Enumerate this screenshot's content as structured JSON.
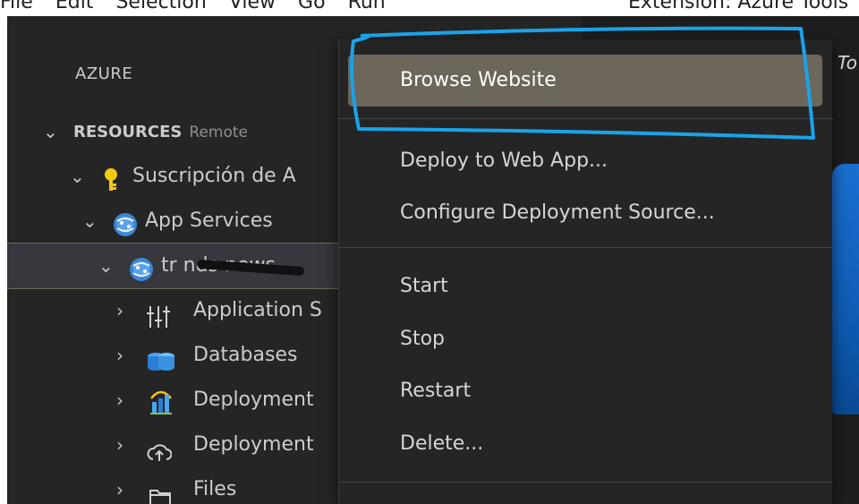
{
  "menubar": {
    "items": [
      "File",
      "Edit",
      "Selection",
      "View",
      "Go",
      "Run"
    ],
    "extension_title": "Extension: Azure Tools"
  },
  "editor": {
    "tab_fragment": "To"
  },
  "sidebar": {
    "header": "AZURE",
    "resources": {
      "title": "RESOURCES",
      "subtitle": "Remote"
    },
    "subscription": {
      "label": "Suscripción de A"
    },
    "app_services": {
      "label": "App Services"
    },
    "webapp": {
      "label": "tr nds news"
    },
    "children": [
      {
        "label": "Application S",
        "icon": "sliders-icon"
      },
      {
        "label": "Databases",
        "icon": "database-icon"
      },
      {
        "label": "Deployment",
        "icon": "bar-chart-icon"
      },
      {
        "label": "Deployment",
        "icon": "cloud-upload-icon"
      },
      {
        "label": "Files",
        "icon": "folder-icon"
      }
    ]
  },
  "context_menu": {
    "browse": "Browse Website",
    "deploy": "Deploy to Web App...",
    "configure": "Configure Deployment Source...",
    "start": "Start",
    "stop": "Stop",
    "restart": "Restart",
    "delete": "Delete..."
  },
  "colors": {
    "sidebar_bg": "#252526",
    "menu_highlight": "#6c665b",
    "annotation": "#1aa3e8",
    "key_icon": "#f2c811",
    "azure_blue": "#1b6fd1"
  }
}
